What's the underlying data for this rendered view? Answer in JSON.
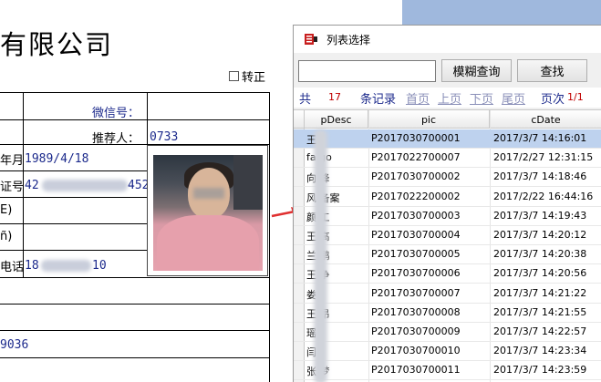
{
  "document": {
    "company_title": "有限公司",
    "transfer_checkbox_label": "转正",
    "wechat_label": "微信号：",
    "referrer_label": "推荐人：",
    "referrer_value": "0733",
    "birth_label": "年月",
    "birth_value": "1989/4/18",
    "id_label": "证号",
    "id_value_start": "42",
    "id_value_end": "452",
    "row_label_1": "E)",
    "row_label_2": "ñ)",
    "phone_label": "电话",
    "phone_value_start": "18",
    "phone_value_end": "10",
    "bottom_value": "9036"
  },
  "dialog": {
    "title": "列表选择",
    "search": {
      "value": "",
      "placeholder": ""
    },
    "buttons": {
      "fuzzy": "模糊查询",
      "search": "查找"
    },
    "pager": {
      "total_prefix": "共",
      "total_count": "17",
      "total_suffix": "条记录",
      "first": "首页",
      "prev": "上页",
      "next": "下页",
      "last": "尾页",
      "page_label": "页次",
      "page_value": "1/1"
    },
    "columns": [
      "pDesc",
      "pic",
      "cDate"
    ],
    "rows": [
      {
        "desc": "王",
        "pic": "P2017030700001",
        "date": "2017/3/7 14:16:01",
        "selected": true
      },
      {
        "desc": "fa    go",
        "pic": "P2017022700007",
        "date": "2017/2/27 12:31:15",
        "selected": false
      },
      {
        "desc": "向    峰",
        "pic": "P2017030700002",
        "date": "2017/3/7 14:18:46",
        "selected": false
      },
      {
        "desc": "风    备案",
        "pic": "P2017022200002",
        "date": "2017/2/22 16:44:16",
        "selected": false
      },
      {
        "desc": "颜    工",
        "pic": "P2017030700003",
        "date": "2017/3/7 14:19:43",
        "selected": false
      },
      {
        "desc": "王    高",
        "pic": "P2017030700004",
        "date": "2017/3/7 14:20:12",
        "selected": false
      },
      {
        "desc": "兰    鹏",
        "pic": "P2017030700005",
        "date": "2017/3/7 14:20:38",
        "selected": false
      },
      {
        "desc": "王    争",
        "pic": "P2017030700006",
        "date": "2017/3/7 14:20:56",
        "selected": false
      },
      {
        "desc": "娄",
        "pic": "P2017030700007",
        "date": "2017/3/7 14:21:22",
        "selected": false
      },
      {
        "desc": "王    昂",
        "pic": "P2017030700008",
        "date": "2017/3/7 14:21:55",
        "selected": false
      },
      {
        "desc": "瑶",
        "pic": "P2017030700009",
        "date": "2017/3/7 14:22:57",
        "selected": false
      },
      {
        "desc": "闫",
        "pic": "P2017030700010",
        "date": "2017/3/7 14:23:34",
        "selected": false
      },
      {
        "desc": "张    梦",
        "pic": "P2017030700011",
        "date": "2017/3/7 14:23:59",
        "selected": false
      }
    ]
  },
  "colors": {
    "selection": "#bed2ee",
    "accent_blue": "#1c2a8c",
    "arrow_red": "#e03030",
    "count_red": "#c00000"
  },
  "icons": {
    "app": "red-list-icon",
    "arrow": "red-arrow-right-icon"
  }
}
